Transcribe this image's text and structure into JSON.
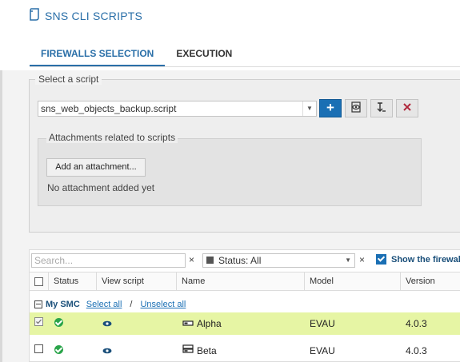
{
  "header": {
    "title": "SNS CLI SCRIPTS"
  },
  "tabs": [
    {
      "label": "FIREWALLS SELECTION",
      "active": true
    },
    {
      "label": "EXECUTION",
      "active": false
    }
  ],
  "script_section": {
    "legend": "Select a script",
    "selected_script": "sns_web_objects_backup.script",
    "add_label": "+"
  },
  "attachments": {
    "legend": "Attachments related to scripts",
    "add_button": "Add an attachment...",
    "empty_text": "No attachment added yet"
  },
  "filters": {
    "search_placeholder": "Search...",
    "status_value": "Status: All",
    "clear": "×",
    "show_firewalls_label": "Show the firewalls"
  },
  "table": {
    "columns": [
      "Status",
      "View script",
      "Name",
      "Model",
      "Version"
    ],
    "group": {
      "name": "My SMC",
      "select_all": "Select all",
      "separator": "/",
      "unselect_all": "Unselect all"
    },
    "rows": [
      {
        "name": "Alpha",
        "model": "EVAU",
        "version": "4.0.3",
        "selected": true
      },
      {
        "name": "Beta",
        "model": "EVAU",
        "version": "4.0.3",
        "selected": false
      }
    ]
  },
  "colors": {
    "accent": "#2a6fa8",
    "button_blue": "#1a6fb4",
    "selected_row": "#e6f5a4",
    "status_ok": "#2aa44a",
    "remove_red": "#b0283c"
  },
  "icons": [
    "script-icon",
    "add-icon",
    "view-script-icon",
    "import-icon",
    "delete-icon",
    "status-filter-icon",
    "ok-status-icon",
    "eye-icon",
    "firewall-icon",
    "collapse-icon"
  ]
}
